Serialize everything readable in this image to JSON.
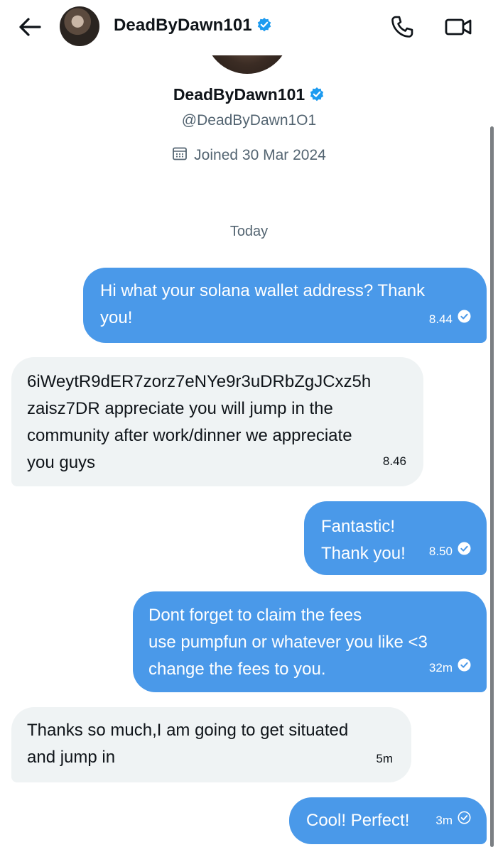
{
  "header": {
    "contact_name": "DeadByDawn101",
    "back_icon": "arrow-left-icon",
    "phone_icon": "phone-icon",
    "video_icon": "video-camera-icon",
    "verified_icon": "verified-badge-icon"
  },
  "profile": {
    "name": "DeadByDawn101",
    "handle": "@DeadByDawn1O1",
    "joined": "Joined 30 Mar 2024",
    "calendar_icon": "calendar-icon"
  },
  "date_divider": "Today",
  "colors": {
    "sent_bubble": "#4a99e9",
    "received_bubble": "#eff3f4",
    "verified": "#1d9bf0",
    "muted_text": "#536471"
  },
  "messages": [
    {
      "direction": "sent",
      "text": "Hi what your solana wallet address? Thank\nyou!",
      "time": "8.44",
      "read": true
    },
    {
      "direction": "received",
      "text": "6iWeytR9dER7zorz7eNYe9r3uDRbZgJCxz5h\nzaisz7DR appreciate you will jump in the\ncommunity after work/dinner we appreciate\nyou guys",
      "time": "8.46"
    },
    {
      "direction": "sent",
      "text": "Fantastic!\nThank you!",
      "time": "8.50",
      "read": true
    },
    {
      "direction": "sent",
      "text": "Dont forget to claim the fees\nuse pumpfun or whatever you like <3\nchange the fees to you.",
      "time": "32m",
      "read": true
    },
    {
      "direction": "received",
      "text": "Thanks so much,I am going to get situated\nand jump in",
      "time": "5m"
    },
    {
      "direction": "sent",
      "text": "Cool! Perfect!",
      "time": "3m",
      "read": false
    }
  ]
}
